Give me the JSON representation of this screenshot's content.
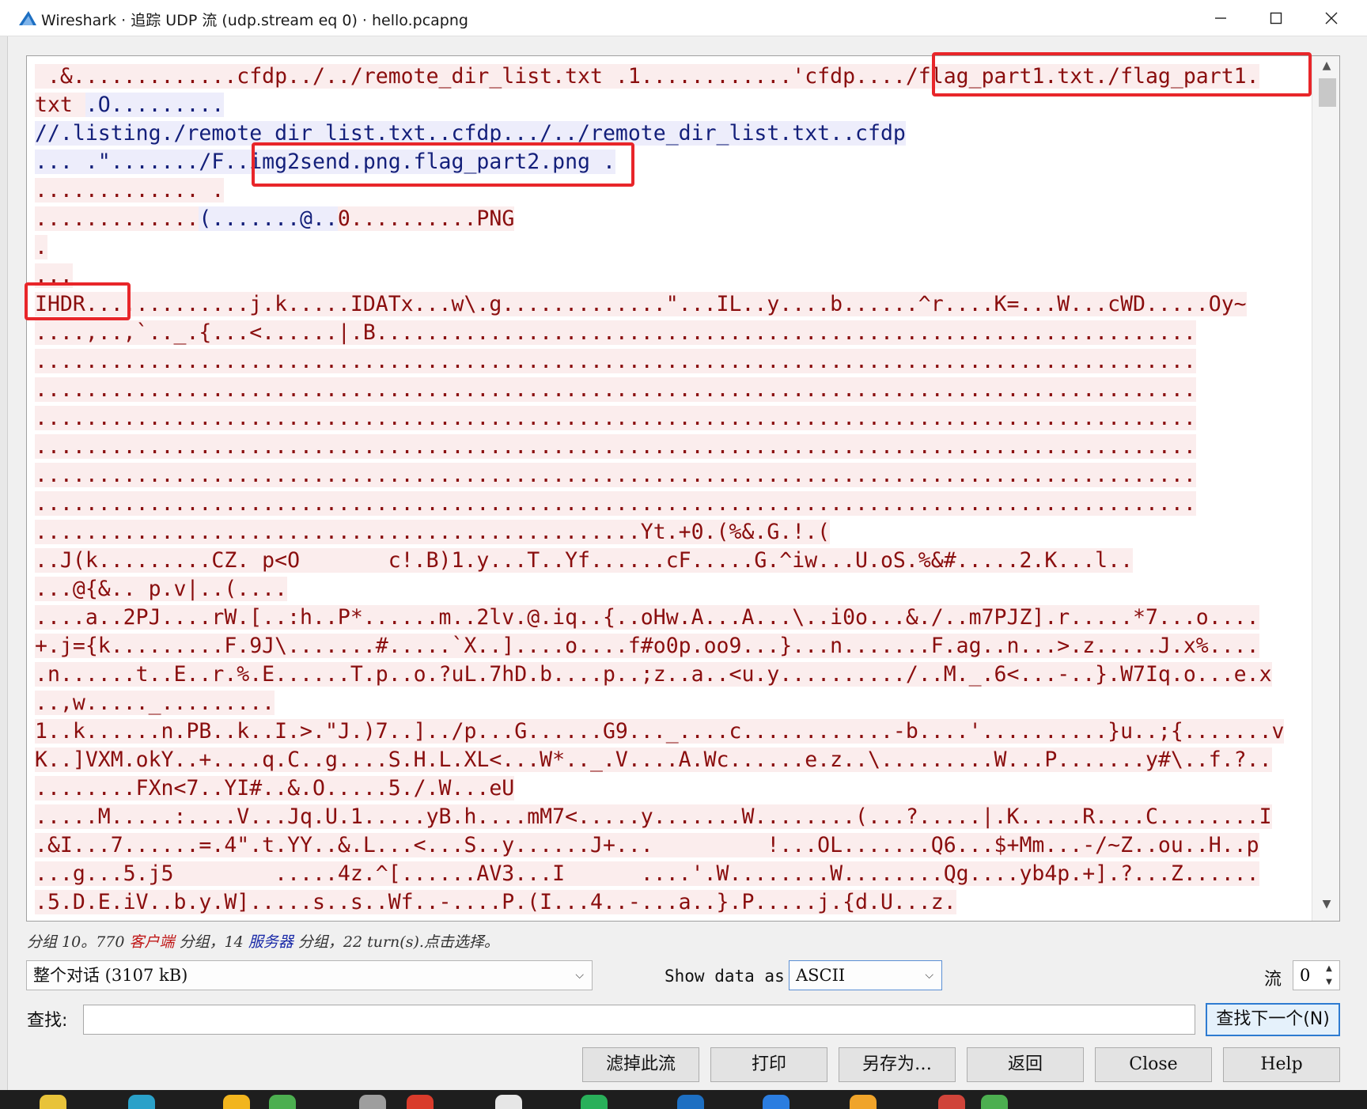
{
  "window": {
    "title": "Wireshark · 追踪 UDP 流 (udp.stream eq 0) · hello.pcapng"
  },
  "stream_lines": [
    [
      {
        "t": " .&.............cfdp../../remote_dir_list.txt .1............'cfdp..../flag_part1.txt./flag_part1.",
        "c": "client"
      }
    ],
    [
      {
        "t": "txt ",
        "c": "client"
      },
      {
        "t": ".O.........",
        "c": "server"
      }
    ],
    [
      {
        "t": "//.listing./remote_dir_list.txt..cfdp.../../remote_dir_list.txt..cfdp",
        "c": "server"
      }
    ],
    [
      {
        "t": "... .\"......./F..img2send.png.flag_part2.png .",
        "c": "server"
      }
    ],
    [
      {
        "t": "............. .",
        "c": "client"
      }
    ],
    [
      {
        "t": ".............",
        "c": "client"
      },
      {
        "t": "(.......@..",
        "c": "server"
      },
      {
        "t": "0..........PNG",
        "c": "client"
      }
    ],
    [
      {
        "t": ".",
        "c": "client"
      }
    ],
    [
      {
        "t": "...",
        "c": "client"
      }
    ],
    [
      {
        "t": "IHDR.............j.k.....IDATx...w\\.g.............\"...IL..y....b......^r....K=...W...cWD.....Oy~",
        "c": "client"
      }
    ],
    [
      {
        "t": "....,..,`.._.{...<......|.B.................................................................",
        "c": "client"
      }
    ],
    [
      {
        "t": "............................................................................................",
        "c": "client"
      }
    ],
    [
      {
        "t": "............................................................................................",
        "c": "client"
      }
    ],
    [
      {
        "t": "............................................................................................",
        "c": "client"
      }
    ],
    [
      {
        "t": "............................................................................................",
        "c": "client"
      }
    ],
    [
      {
        "t": "............................................................................................",
        "c": "client"
      }
    ],
    [
      {
        "t": "............................................................................................",
        "c": "client"
      }
    ],
    [
      {
        "t": "................................................Yt.+0.(%&.G.!.(",
        "c": "client"
      }
    ],
    [
      {
        "t": "..J(k.........CZ. p<O       c!.B)1.y...T..Yf......cF.....G.^iw...U.oS.%&#.....2.K...l..",
        "c": "client"
      }
    ],
    [
      {
        "t": "...@{&.. p.v|..(....",
        "c": "client"
      }
    ],
    [
      {
        "t": "....a..2PJ....rW.[..:h..P*......m..2lv.@.iq..{..oHw.A...A...\\..i0o...&./..m7PJZ].r.....*7...o....",
        "c": "client"
      }
    ],
    [
      {
        "t": "+.j={k.........F.9J\\.......#.....`X..]....o....f#o0p.oo9...}...n.......F.ag..n...>.z.....J.x%....",
        "c": "client"
      }
    ],
    [
      {
        "t": ".n......t..E..r.%.E......T.p..o.?uL.7hD.b....p..;z..a..<u.y........../..M._.6<...-..}.W7Iq.o...e.x",
        "c": "client"
      }
    ],
    [
      {
        "t": "..,w....._.........",
        "c": "client"
      }
    ],
    [
      {
        "t": "1..k......n.PB..k..I.>.\"J.)7..]../p...G......G9..._....c............-b....'..........}u..;{.......v",
        "c": "client"
      }
    ],
    [
      {
        "t": "K..]VXM.okY..+....q.C..g....S.H.L.XL<...W*.._.V....A.Wc......e.z..\\.........W...P.......y#\\..f.?..",
        "c": "client"
      }
    ],
    [
      {
        "t": "........FXn<7..YI#..&.O.....5./.W...eU",
        "c": "client"
      }
    ],
    [
      {
        "t": ".....M.....:....V...Jq.U.1.....yB.h....mM7<.....y.......W........(...?.....|.K.....R....C........I",
        "c": "client"
      }
    ],
    [
      {
        "t": ".&I...7......=.4\".t.YY..&.L...<...S..y......J+...         !...OL.......Q6...$+Mm...-/~Z..ou..H..p",
        "c": "client"
      }
    ],
    [
      {
        "t": "...g...5.j5        .....4z.^[......AV3...I      ....'.W........W........Qg....yb4p.+].?...Z......",
        "c": "client"
      }
    ],
    [
      {
        "t": ".5.D.E.iV..b.y.W].....s..s..Wf..-....P.(I...4..-...a..}.P.....j.{d.U...z.",
        "c": "client"
      }
    ]
  ],
  "status": {
    "prefix": "分组 10。770 ",
    "client": "客户端",
    "middle": " 分组，14 ",
    "server": "服务器",
    "suffix": " 分组，22 turn(s).点击选择。"
  },
  "controls": {
    "conversation": "整个对话 (3107 kB)",
    "show_label": "Show data as",
    "show_value": "ASCII",
    "stream_label": "流",
    "stream_value": "0"
  },
  "find": {
    "label": "查找:",
    "value": "",
    "next_button": "查找下一个(N)"
  },
  "buttons": {
    "filter": "滤掉此流",
    "print": "打印",
    "save_as": "另存为…",
    "back": "返回",
    "close": "Close",
    "help": "Help"
  },
  "colors": {
    "client_bg": "#fbeded",
    "client_fg": "#8a0e0e",
    "server_bg": "#ededfb",
    "server_fg": "#131f7a",
    "annotation": "#e8262a"
  }
}
